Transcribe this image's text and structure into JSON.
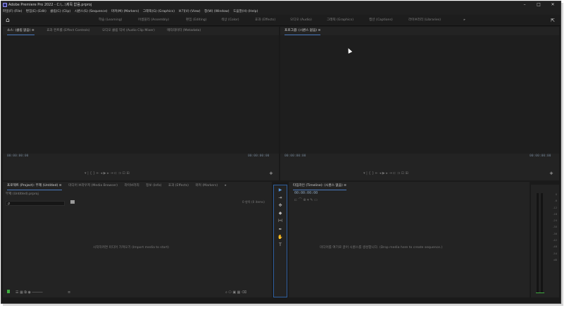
{
  "window": {
    "title": "Adobe Premiere Pro 2022 - C:\\...\\제목 없음.prproj",
    "minimize": "–",
    "maximize": "□",
    "close": "✕"
  },
  "menu": [
    "파일(F) (File)",
    "편집(E) (Edit)",
    "클립(C) (Clip)",
    "시퀀스(S) (Sequence)",
    "마커(M) (Markers)",
    "그래픽(G) (Graphics)",
    "보기(V) (View)",
    "창(W) (Window)",
    "도움말(H) (Help)"
  ],
  "workspaces": [
    {
      "label": "학습 (Learning)"
    },
    {
      "label": "어셈블리 (Assembly)"
    },
    {
      "label": "편집 (Editing)"
    },
    {
      "label": "색상 (Color)"
    },
    {
      "label": "효과 (Effects)"
    },
    {
      "label": "오디오 (Audio)"
    },
    {
      "label": "그래픽 (Graphics)"
    },
    {
      "label": "캡션 (Captions)"
    },
    {
      "label": "라이브러리 (Libraries)"
    }
  ],
  "workspace_more": "»",
  "source_panel": {
    "tabs": [
      "소스: (클립 없음) ≡",
      "효과 컨트롤 (Effect Controls)",
      "오디오 클립 믹서 (Audio Clip Mixer)",
      "메타데이터 (Metadata)"
    ],
    "timecode_left": "00:00:00:00",
    "timecode_right": "00:00:00:00",
    "controls": "▾  |  {  }  ⇤  ◂  ▶  ▸  ⇥  ⊏  ⊐  ⊡  ⊞",
    "add": "+"
  },
  "program_panel": {
    "tab": "프로그램: (시퀀스 없음) ≡",
    "timecode_left": "00:00:00:00",
    "timecode_right": "00:00:00:00",
    "controls": "▾  |  {  }  ⇤  ◂  ▶  ▸  ⇥  ⊏  ⊐  ⊡  ⊞",
    "add": "+"
  },
  "project_panel": {
    "tabs": [
      "프로젝트 (Project): 무제 (Untitled) ≡",
      "미디어 브라우저 (Media Browser)",
      "라이브러리",
      "정보 (Info)",
      "효과 (Effects)",
      "마커 (Markers)",
      "»"
    ],
    "project_name": "무제 (Untitled).prproj",
    "search_placeholder": "ρ",
    "items_count": "0 항목 (0 items)",
    "empty_message": "시작하려면 미디어 가져오기 (Import media to start)"
  },
  "timeline_panel": {
    "tab": "타임라인 (Timeline): (시퀀스 없음) ≡",
    "timecode": "00:00:00:00",
    "empty_message": "미디어를 여기로 끌어 시퀀스를 생성합니다. (Drop media here to create sequence.)"
  },
  "tools": [
    "▶",
    "⇥",
    "✥",
    "◆",
    "|↔|",
    "✒",
    "✋",
    "T"
  ],
  "meter_scale": [
    "0",
    "-6",
    "-12",
    "-18",
    "-24",
    "-30",
    "-36",
    "-42",
    "-48",
    "-54",
    "dB",
    "",
    "",
    "",
    "-"
  ],
  "colors": {
    "accent": "#4a7ac0",
    "panel": "#232323",
    "background": "#1a1a1a"
  }
}
